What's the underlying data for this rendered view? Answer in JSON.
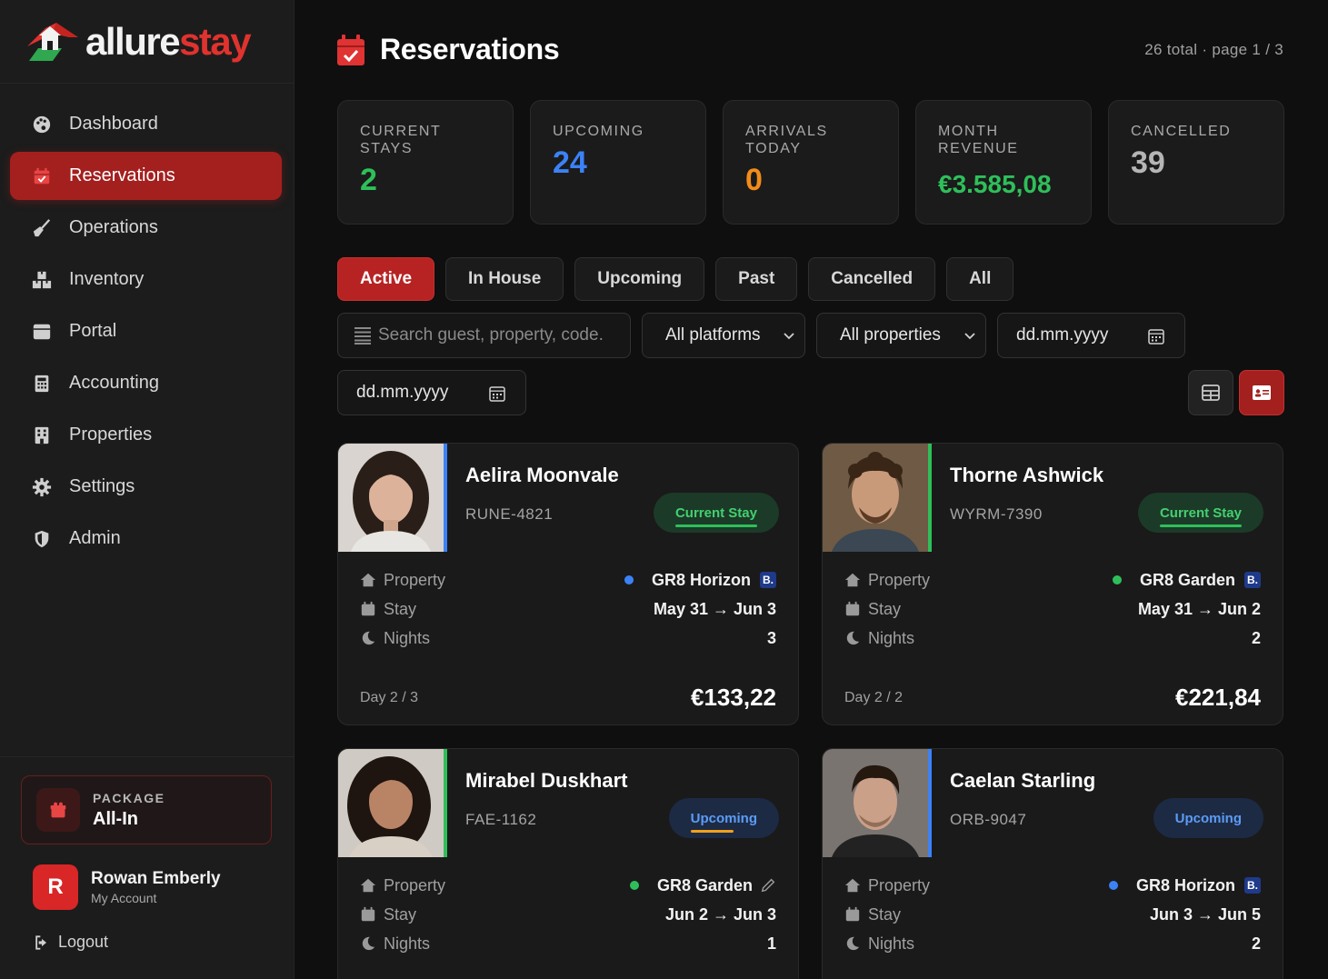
{
  "brand": {
    "part1": "allure",
    "part2": "stay",
    "accent": "#e0322e",
    "green": "#2fa84f"
  },
  "sidebar": {
    "items": [
      {
        "label": "Dashboard",
        "icon": "palette-icon"
      },
      {
        "label": "Reservations",
        "icon": "calendar-check-icon",
        "active": true
      },
      {
        "label": "Operations",
        "icon": "broom-icon"
      },
      {
        "label": "Inventory",
        "icon": "boxes-icon"
      },
      {
        "label": "Portal",
        "icon": "window-icon"
      },
      {
        "label": "Accounting",
        "icon": "calculator-icon"
      },
      {
        "label": "Properties",
        "icon": "building-icon"
      },
      {
        "label": "Settings",
        "icon": "gear-icon"
      },
      {
        "label": "Admin",
        "icon": "shield-icon"
      }
    ],
    "package": {
      "label": "PACKAGE",
      "value": "All-In"
    },
    "user": {
      "initial": "R",
      "name": "Rowan Emberly",
      "sub": "My Account"
    },
    "logout": "Logout"
  },
  "header": {
    "title": "Reservations",
    "meta": "26 total · page 1 / 3"
  },
  "stats": [
    {
      "label": "CURRENT STAYS",
      "value": "2",
      "color": "#2fbf5a"
    },
    {
      "label": "UPCOMING",
      "value": "24",
      "color": "#3b82f6"
    },
    {
      "label": "ARRIVALS TODAY",
      "value": "0",
      "color": "#f28c1a"
    },
    {
      "label": "MONTH REVENUE",
      "value": "€3.585,08",
      "color": "#2fbf5a"
    },
    {
      "label": "CANCELLED",
      "value": "39",
      "color": "#b5b5b5"
    }
  ],
  "filters": [
    "Active",
    "In House",
    "Upcoming",
    "Past",
    "Cancelled",
    "All"
  ],
  "search": {
    "placeholder": "Search guest, property, code."
  },
  "platform_select": "All platforms",
  "property_select": "All properties",
  "date_from": "dd.mm.yyyy",
  "date_to": "dd.mm.yyyy",
  "labels": {
    "property": "Property",
    "stay": "Stay",
    "nights": "Nights"
  },
  "cards": [
    {
      "name": "Aelira Moonvale",
      "code": "RUNE-4821",
      "status": "Current Stay",
      "property": "GR8 Horizon",
      "stay": "May 31 → Jun 3",
      "nights": "3",
      "day": "Day 2 / 3",
      "price": "€133,22",
      "bar_color": "#3b82f6",
      "dot_color": "#3b82f6"
    },
    {
      "name": "Thorne Ashwick",
      "code": "WYRM-7390",
      "status": "Current Stay",
      "property": "GR8 Garden",
      "stay": "May 31 → Jun 2",
      "nights": "2",
      "day": "Day 2 / 2",
      "price": "€221,84",
      "bar_color": "#2fbf5a",
      "dot_color": "#2fbf5a"
    },
    {
      "name": "Mirabel Duskhart",
      "code": "FAE-1162",
      "status": "Upcoming",
      "property": "GR8 Garden",
      "stay": "Jun 2 → Jun 3",
      "nights": "1",
      "bar_color": "#2fbf5a",
      "dot_color": "#2fbf5a"
    },
    {
      "name": "Caelan Starling",
      "code": "ORB-9047",
      "status": "Upcoming",
      "property": "GR8 Horizon",
      "stay": "Jun 3 → Jun 5",
      "nights": "2",
      "bar_color": "#3b82f6",
      "dot_color": "#3b82f6"
    }
  ],
  "booking_mark": "B."
}
